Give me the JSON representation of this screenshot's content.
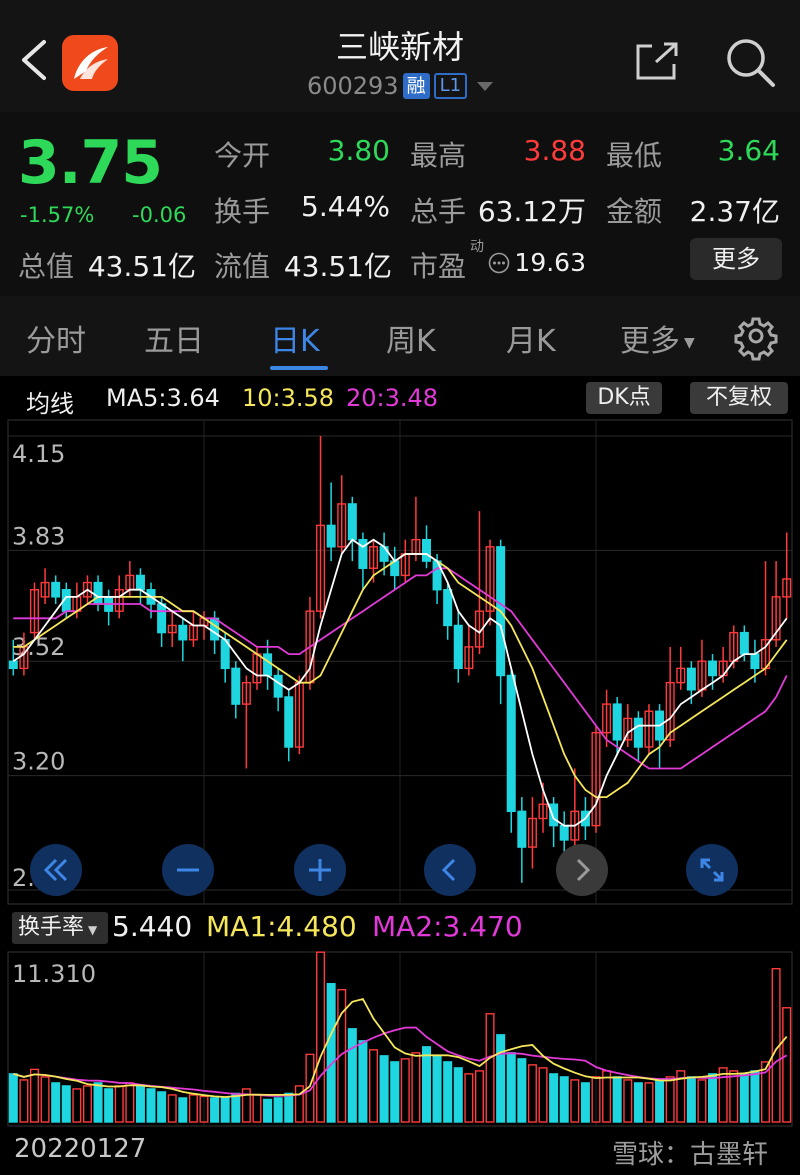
{
  "header": {
    "title": "三峡新材",
    "code": "600293",
    "tag_margin": "融",
    "tag_level": "L1"
  },
  "quote": {
    "price": "3.75",
    "pct_change": "-1.57%",
    "change": "-0.06",
    "open_label": "今开",
    "open_value": "3.80",
    "high_label": "最高",
    "high_value": "3.88",
    "low_label": "最低",
    "low_value": "3.64",
    "turnover_label": "换手",
    "turnover_value": "5.44%",
    "volume_label": "总手",
    "volume_value": "63.12万",
    "amount_label": "金额",
    "amount_value": "2.37亿",
    "mktcap_label": "总值",
    "mktcap_value": "43.51亿",
    "float_label": "流值",
    "float_value": "43.51亿",
    "pe_label": "市盈",
    "pe_sup": "动",
    "pe_value": "19.63",
    "more_label": "更多"
  },
  "tabs": {
    "items": [
      "分时",
      "五日",
      "日K",
      "周K",
      "月K",
      "更多"
    ],
    "active": "日K"
  },
  "ma_legend": {
    "title": "均线",
    "ma5": "MA5:3.64",
    "ma10": "10:3.58",
    "ma20": "20:3.48",
    "dk_label": "DK点",
    "adjust_label": "不复权"
  },
  "price_axis": [
    "4.15",
    "3.83",
    "3.52",
    "3.20",
    "2.88"
  ],
  "turnover_legend": {
    "selector": "换手率",
    "value": "5.440",
    "ma1": "MA1:4.480",
    "ma2": "MA2:3.470",
    "max_label": "11.310"
  },
  "footer": {
    "date": "20220127",
    "watermark": "雪球：古墨轩"
  },
  "colors": {
    "up": "#ff3b3b",
    "down": "#1fd6e0",
    "ma5": "#ffffff",
    "ma10": "#f5e65a",
    "ma20": "#e23ad8",
    "accent": "#3e86e6"
  },
  "chart_data": {
    "type": "candlestick",
    "ylim": [
      2.88,
      4.15
    ],
    "candles": [
      [
        3.52,
        3.5,
        3.58,
        3.48
      ],
      [
        3.5,
        3.56,
        3.6,
        3.48
      ],
      [
        3.6,
        3.72,
        3.74,
        3.58
      ],
      [
        3.7,
        3.74,
        3.78,
        3.68
      ],
      [
        3.74,
        3.7,
        3.76,
        3.68
      ],
      [
        3.72,
        3.66,
        3.74,
        3.64
      ],
      [
        3.66,
        3.7,
        3.74,
        3.64
      ],
      [
        3.7,
        3.74,
        3.76,
        3.68
      ],
      [
        3.74,
        3.68,
        3.76,
        3.66
      ],
      [
        3.7,
        3.66,
        3.72,
        3.62
      ],
      [
        3.66,
        3.72,
        3.76,
        3.64
      ],
      [
        3.72,
        3.76,
        3.8,
        3.7
      ],
      [
        3.76,
        3.72,
        3.78,
        3.68
      ],
      [
        3.72,
        3.68,
        3.74,
        3.64
      ],
      [
        3.68,
        3.6,
        3.7,
        3.56
      ],
      [
        3.6,
        3.62,
        3.66,
        3.56
      ],
      [
        3.62,
        3.58,
        3.64,
        3.52
      ],
      [
        3.58,
        3.62,
        3.66,
        3.56
      ],
      [
        3.62,
        3.64,
        3.66,
        3.58
      ],
      [
        3.64,
        3.58,
        3.66,
        3.54
      ],
      [
        3.58,
        3.5,
        3.6,
        3.46
      ],
      [
        3.5,
        3.4,
        3.52,
        3.36
      ],
      [
        3.4,
        3.46,
        3.48,
        3.22
      ],
      [
        3.46,
        3.54,
        3.56,
        3.44
      ],
      [
        3.54,
        3.48,
        3.58,
        3.44
      ],
      [
        3.48,
        3.42,
        3.5,
        3.38
      ],
      [
        3.42,
        3.28,
        3.44,
        3.24
      ],
      [
        3.28,
        3.46,
        3.48,
        3.26
      ],
      [
        3.46,
        3.66,
        3.7,
        3.44
      ],
      [
        3.66,
        3.9,
        4.15,
        3.64
      ],
      [
        3.9,
        3.84,
        4.02,
        3.8
      ],
      [
        3.84,
        3.96,
        4.04,
        3.82
      ],
      [
        3.96,
        3.86,
        3.98,
        3.8
      ],
      [
        3.86,
        3.78,
        3.88,
        3.72
      ],
      [
        3.78,
        3.84,
        3.86,
        3.74
      ],
      [
        3.84,
        3.8,
        3.88,
        3.76
      ],
      [
        3.8,
        3.76,
        3.84,
        3.72
      ],
      [
        3.76,
        3.82,
        3.86,
        3.74
      ],
      [
        3.82,
        3.86,
        3.98,
        3.8
      ],
      [
        3.86,
        3.8,
        3.9,
        3.78
      ],
      [
        3.8,
        3.72,
        3.82,
        3.68
      ],
      [
        3.72,
        3.62,
        3.74,
        3.58
      ],
      [
        3.62,
        3.5,
        3.66,
        3.46
      ],
      [
        3.5,
        3.56,
        3.62,
        3.48
      ],
      [
        3.56,
        3.66,
        3.94,
        3.54
      ],
      [
        3.66,
        3.84,
        3.86,
        3.62
      ],
      [
        3.84,
        3.48,
        3.86,
        3.4
      ],
      [
        3.48,
        3.1,
        3.5,
        3.04
      ],
      [
        3.1,
        3.0,
        3.14,
        2.9
      ],
      [
        3.0,
        3.08,
        3.14,
        2.94
      ],
      [
        3.08,
        3.12,
        3.18,
        3.04
      ],
      [
        3.12,
        3.06,
        3.14,
        3.0
      ],
      [
        3.06,
        3.02,
        3.1,
        2.98
      ],
      [
        3.02,
        3.1,
        3.22,
        3.0
      ],
      [
        3.1,
        3.06,
        3.14,
        3.02
      ],
      [
        3.06,
        3.32,
        3.34,
        3.04
      ],
      [
        3.32,
        3.4,
        3.44,
        3.28
      ],
      [
        3.4,
        3.3,
        3.42,
        3.26
      ],
      [
        3.3,
        3.36,
        3.4,
        3.28
      ],
      [
        3.36,
        3.28,
        3.38,
        3.24
      ],
      [
        3.28,
        3.38,
        3.4,
        3.26
      ],
      [
        3.38,
        3.3,
        3.4,
        3.22
      ],
      [
        3.3,
        3.46,
        3.56,
        3.28
      ],
      [
        3.46,
        3.5,
        3.56,
        3.44
      ],
      [
        3.5,
        3.44,
        3.52,
        3.4
      ],
      [
        3.44,
        3.52,
        3.58,
        3.42
      ],
      [
        3.52,
        3.48,
        3.54,
        3.44
      ],
      [
        3.48,
        3.52,
        3.56,
        3.46
      ],
      [
        3.52,
        3.6,
        3.62,
        3.5
      ],
      [
        3.6,
        3.54,
        3.62,
        3.52
      ],
      [
        3.54,
        3.5,
        3.58,
        3.46
      ],
      [
        3.5,
        3.58,
        3.8,
        3.48
      ],
      [
        3.58,
        3.7,
        3.8,
        3.56
      ],
      [
        3.7,
        3.75,
        3.88,
        3.64
      ]
    ],
    "ma5": [
      3.52,
      3.54,
      3.58,
      3.62,
      3.66,
      3.7,
      3.7,
      3.72,
      3.7,
      3.7,
      3.7,
      3.72,
      3.72,
      3.7,
      3.68,
      3.66,
      3.64,
      3.62,
      3.62,
      3.6,
      3.58,
      3.54,
      3.5,
      3.48,
      3.48,
      3.46,
      3.44,
      3.46,
      3.5,
      3.62,
      3.72,
      3.82,
      3.86,
      3.84,
      3.86,
      3.84,
      3.8,
      3.82,
      3.82,
      3.82,
      3.8,
      3.74,
      3.66,
      3.62,
      3.6,
      3.64,
      3.62,
      3.5,
      3.38,
      3.26,
      3.16,
      3.08,
      3.06,
      3.06,
      3.08,
      3.12,
      3.2,
      3.26,
      3.32,
      3.34,
      3.34,
      3.34,
      3.36,
      3.4,
      3.42,
      3.44,
      3.46,
      3.48,
      3.52,
      3.54,
      3.54,
      3.56,
      3.6,
      3.64
    ],
    "ma10": [
      3.56,
      3.56,
      3.58,
      3.6,
      3.62,
      3.64,
      3.66,
      3.68,
      3.7,
      3.7,
      3.7,
      3.7,
      3.7,
      3.7,
      3.7,
      3.68,
      3.66,
      3.66,
      3.64,
      3.62,
      3.6,
      3.58,
      3.56,
      3.54,
      3.52,
      3.5,
      3.48,
      3.46,
      3.46,
      3.48,
      3.54,
      3.6,
      3.66,
      3.72,
      3.76,
      3.78,
      3.8,
      3.82,
      3.82,
      3.82,
      3.8,
      3.78,
      3.74,
      3.72,
      3.7,
      3.68,
      3.66,
      3.62,
      3.56,
      3.5,
      3.42,
      3.34,
      3.26,
      3.2,
      3.16,
      3.14,
      3.14,
      3.16,
      3.18,
      3.22,
      3.26,
      3.28,
      3.32,
      3.34,
      3.36,
      3.38,
      3.4,
      3.42,
      3.44,
      3.46,
      3.48,
      3.5,
      3.54,
      3.58
    ],
    "ma20": [
      3.64,
      3.64,
      3.64,
      3.64,
      3.64,
      3.66,
      3.66,
      3.68,
      3.68,
      3.68,
      3.68,
      3.68,
      3.68,
      3.66,
      3.66,
      3.66,
      3.66,
      3.66,
      3.64,
      3.64,
      3.62,
      3.6,
      3.58,
      3.56,
      3.56,
      3.56,
      3.54,
      3.54,
      3.56,
      3.58,
      3.6,
      3.62,
      3.64,
      3.66,
      3.68,
      3.7,
      3.72,
      3.74,
      3.76,
      3.76,
      3.78,
      3.78,
      3.76,
      3.74,
      3.72,
      3.7,
      3.68,
      3.66,
      3.62,
      3.58,
      3.54,
      3.5,
      3.46,
      3.42,
      3.38,
      3.34,
      3.3,
      3.28,
      3.26,
      3.24,
      3.22,
      3.22,
      3.22,
      3.22,
      3.24,
      3.26,
      3.28,
      3.3,
      3.32,
      3.34,
      3.36,
      3.38,
      3.42,
      3.48
    ],
    "turnover": [
      3.2,
      2.8,
      3.5,
      3.0,
      2.6,
      2.4,
      2.2,
      2.4,
      2.6,
      2.2,
      2.4,
      2.6,
      2.4,
      2.2,
      2.0,
      1.8,
      1.6,
      1.8,
      1.7,
      1.6,
      1.6,
      1.9,
      2.2,
      1.8,
      1.5,
      1.6,
      1.9,
      2.4,
      4.5,
      11.3,
      9.2,
      8.8,
      6.2,
      5.4,
      4.8,
      4.4,
      4.0,
      4.2,
      4.6,
      5.0,
      4.4,
      4.0,
      3.6,
      3.2,
      3.4,
      7.2,
      5.8,
      4.6,
      4.2,
      3.8,
      3.6,
      3.2,
      3.0,
      2.8,
      2.6,
      3.0,
      3.4,
      3.0,
      2.8,
      2.6,
      2.6,
      2.8,
      3.0,
      3.4,
      3.0,
      2.8,
      3.2,
      3.6,
      3.4,
      3.2,
      3.4,
      4.0,
      10.2,
      7.6
    ],
    "turnover_max": 11.31
  }
}
